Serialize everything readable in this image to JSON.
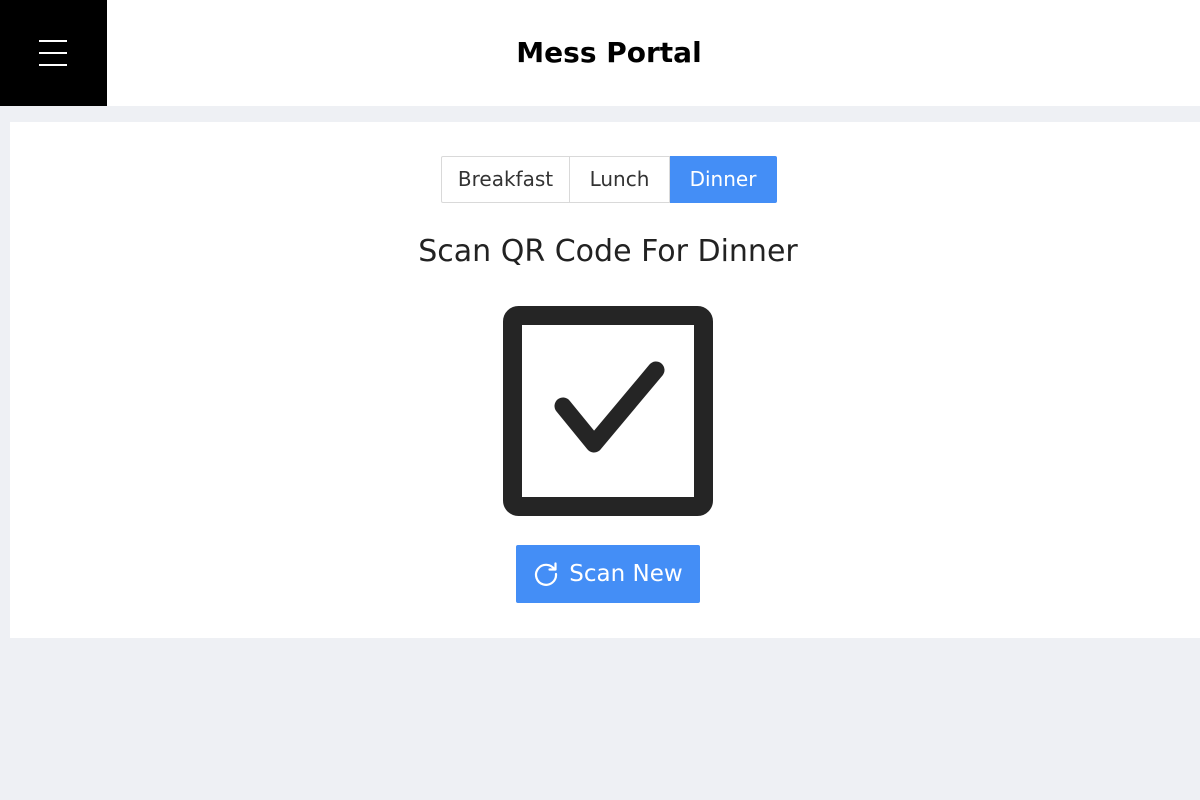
{
  "header": {
    "title": "Mess Portal",
    "menu_icon": "hamburger-menu-icon"
  },
  "meal_tabs": [
    {
      "label": "Breakfast",
      "selected": false
    },
    {
      "label": "Lunch",
      "selected": false
    },
    {
      "label": "Dinner",
      "selected": true
    }
  ],
  "scan": {
    "heading": "Scan QR Code For Dinner",
    "status_icon": "checkbox-checked-icon",
    "button_label": "Scan New",
    "button_icon": "refresh-icon"
  },
  "colors": {
    "accent": "#448ef6",
    "header_bg": "#ffffff",
    "menu_bg": "#000000",
    "page_bg": "#eef0f4",
    "status_icon": "#252525"
  }
}
